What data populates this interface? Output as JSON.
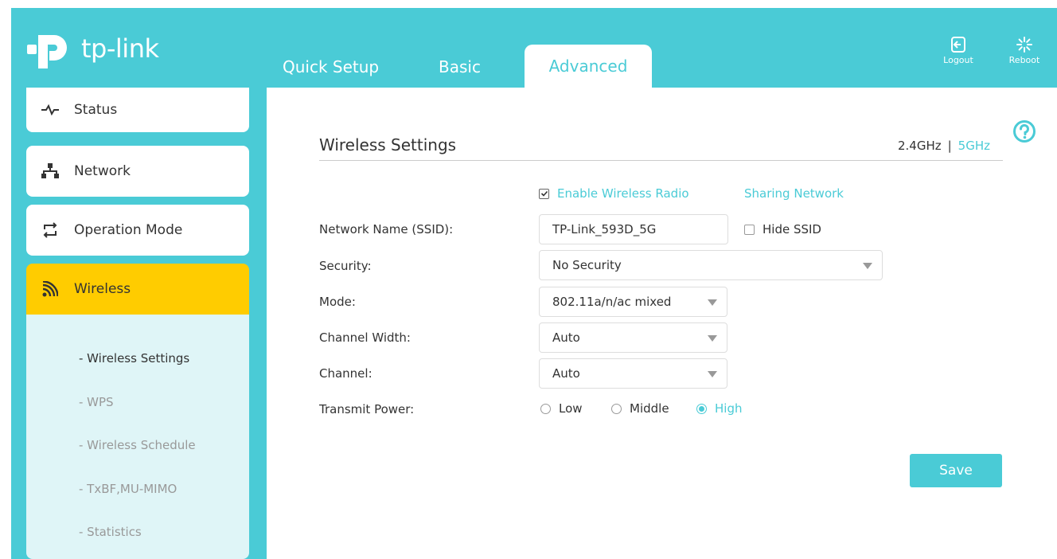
{
  "header": {
    "brand": "tp-link",
    "tabs": [
      {
        "label": "Quick Setup"
      },
      {
        "label": "Basic"
      },
      {
        "label": "Advanced"
      }
    ],
    "logout_label": "Logout",
    "reboot_label": "Reboot"
  },
  "sidebar": {
    "items": [
      {
        "label": "Status",
        "icon": "pulse-icon"
      },
      {
        "label": "Network",
        "icon": "network-icon"
      },
      {
        "label": "Operation Mode",
        "icon": "swap-icon"
      },
      {
        "label": "Wireless",
        "icon": "wifi-icon"
      }
    ],
    "subitems": [
      {
        "label": "- Wireless Settings"
      },
      {
        "label": "- WPS"
      },
      {
        "label": "- Wireless Schedule"
      },
      {
        "label": "- TxBF,MU-MIMO"
      },
      {
        "label": "- Statistics"
      }
    ]
  },
  "main": {
    "title": "Wireless Settings",
    "band_24": "2.4GHz",
    "band_sep": "|",
    "band_5": "5GHz",
    "enable_label": "Enable Wireless Radio",
    "sharing_label": "Sharing Network",
    "ssid_label": "Network Name (SSID):",
    "ssid_value": "TP-Link_593D_5G",
    "hide_ssid_label": "Hide SSID",
    "security_label": "Security:",
    "security_value": "No Security",
    "mode_label": "Mode:",
    "mode_value": "802.11a/n/ac mixed",
    "width_label": "Channel Width:",
    "width_value": "Auto",
    "channel_label": "Channel:",
    "channel_value": "Auto",
    "power_label": "Transmit Power:",
    "power_options": [
      "Low",
      "Middle",
      "High"
    ],
    "save_label": "Save"
  },
  "colors": {
    "accent": "#4acbd6",
    "active_menu": "#ffcc00",
    "submenu_bg": "#dff5f7"
  }
}
